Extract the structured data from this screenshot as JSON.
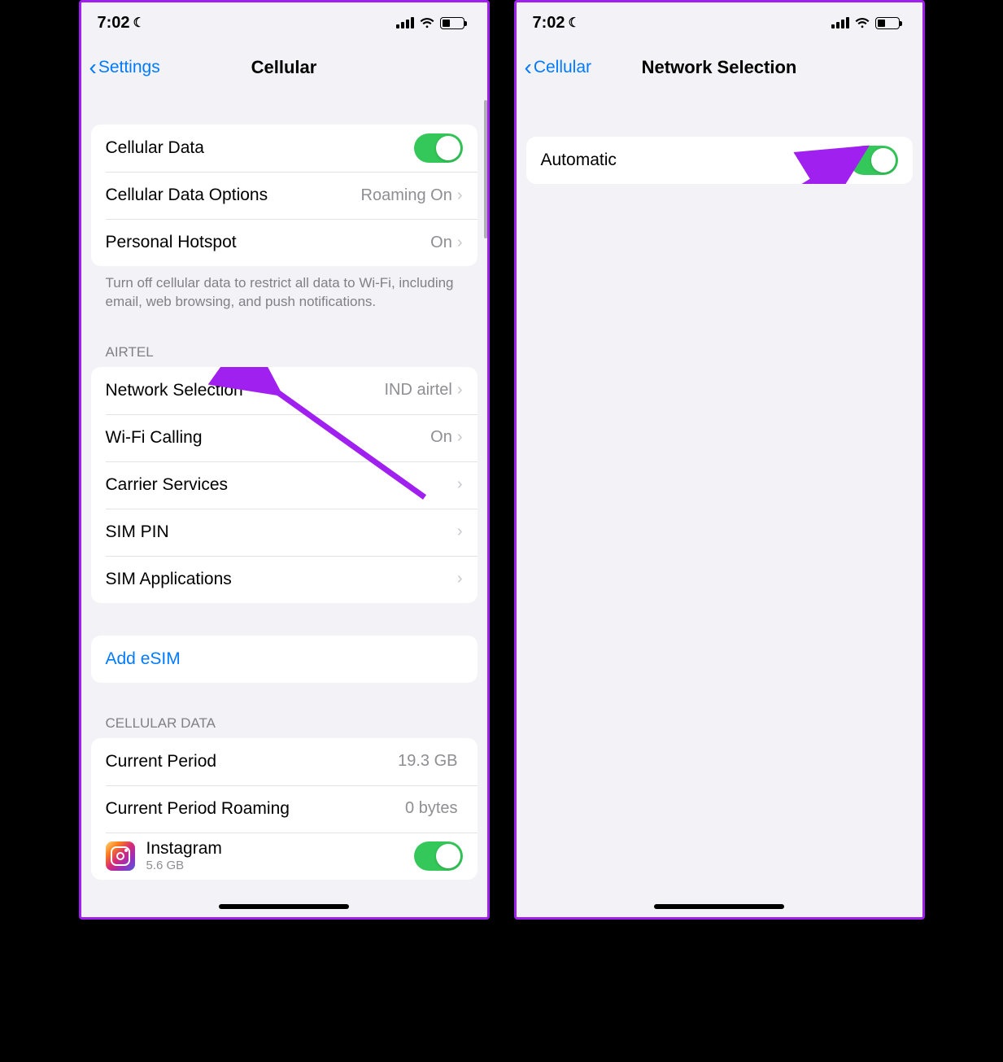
{
  "status": {
    "time": "7:02"
  },
  "left": {
    "back": "Settings",
    "title": "Cellular",
    "rows": {
      "cellular_data": "Cellular Data",
      "cellular_data_options": "Cellular Data Options",
      "cellular_data_options_detail": "Roaming On",
      "personal_hotspot": "Personal Hotspot",
      "personal_hotspot_detail": "On"
    },
    "footer": "Turn off cellular data to restrict all data to Wi-Fi, including email, web browsing, and push notifications.",
    "carrier_header": "AIRTEL",
    "carrier_rows": {
      "network_selection": "Network Selection",
      "network_selection_detail": "IND airtel",
      "wifi_calling": "Wi-Fi Calling",
      "wifi_calling_detail": "On",
      "carrier_services": "Carrier Services",
      "sim_pin": "SIM PIN",
      "sim_apps": "SIM Applications"
    },
    "add_esim": "Add eSIM",
    "usage_header": "CELLULAR DATA",
    "usage": {
      "current_period": "Current Period",
      "current_period_detail": "19.3 GB",
      "current_period_roaming": "Current Period Roaming",
      "current_period_roaming_detail": "0 bytes",
      "app1_name": "Instagram",
      "app1_size": "5.6 GB"
    }
  },
  "right": {
    "back": "Cellular",
    "title": "Network Selection",
    "automatic": "Automatic"
  }
}
